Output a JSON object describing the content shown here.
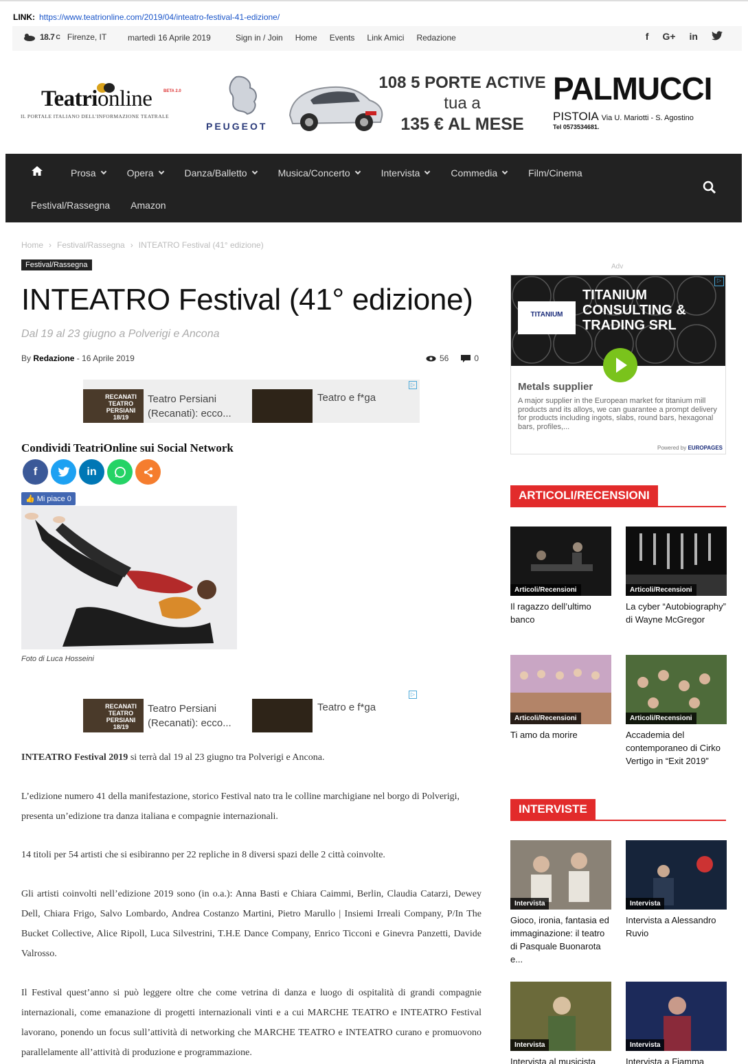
{
  "linkbar": {
    "label": "LINK:",
    "url": "https://www.teatrionline.com/2019/04/inteatro-festival-41-edizione/"
  },
  "topbar": {
    "temp": "18.7",
    "unit": "C",
    "city": "Firenze, IT",
    "date": "martedì 16 Aprile 2019",
    "nav": [
      "Sign in / Join",
      "Home",
      "Events",
      "Link Amici",
      "Redazione"
    ],
    "social": [
      "f",
      "G+",
      "in",
      "t"
    ]
  },
  "logo": {
    "name_a": "Teatri",
    "name_b": "online",
    "beta": "BETA 2.0",
    "tagline": "IL PORTALE ITALIANO DELL'INFORMAZIONE TEATRALE"
  },
  "banner": {
    "brand": "PEUGEOT",
    "line1": "108 5 PORTE ACTIVE",
    "line2": "tua a",
    "line3": "135 € AL MESE",
    "dealer": "PALMUCCI",
    "city": "PISTOIA",
    "addr": "Via U. Mariotti - S. Agostino",
    "tel": "Tel 0573534681."
  },
  "mainnav": {
    "row1": [
      {
        "label": "Prosa",
        "dropdown": true
      },
      {
        "label": "Opera",
        "dropdown": true
      },
      {
        "label": "Danza/Balletto",
        "dropdown": true
      },
      {
        "label": "Musica/Concerto",
        "dropdown": true
      },
      {
        "label": "Intervista",
        "dropdown": true
      },
      {
        "label": "Commedia",
        "dropdown": true
      },
      {
        "label": "Film/Cinema",
        "dropdown": false
      }
    ],
    "row2": [
      "Festival/Rassegna",
      "Amazon"
    ]
  },
  "breadcrumb": [
    "Home",
    "Festival/Rassegna",
    "INTEATRO Festival (41° edizione)"
  ],
  "article": {
    "category": "Festival/Rassegna",
    "title": "INTEATRO Festival (41° edizione)",
    "subtitle": "Dal 19 al 23 giugno a Polverigi e Ancona",
    "by": "By",
    "author": "Redazione",
    "date": "16 Aprile 2019",
    "views": "56",
    "comments": "0",
    "share_title": "Condividi TeatriOnline sui Social Network",
    "like_label": "Mi piace 0",
    "caption": "Foto di Luca Hosseini",
    "p1_bold": "INTEATRO Festival 2019",
    "p1_rest": " si terrà dal 19 al 23 giugno tra Polverigi e Ancona.",
    "p2": "L’edizione numero 41 della manifestazione, storico Festival nato tra le colline marchigiane nel borgo di Polverigi, presenta un’edizione tra danza italiana e compagnie internazionali.",
    "p3": "14 titoli per 54 artisti che si esibiranno per 22 repliche in 8 diversi spazi delle 2 città coinvolte.",
    "p4": "Gli artisti coinvolti nell’edizione 2019 sono (in o.a.): Anna Basti e Chiara Caimmi, Berlin, Claudia Catarzi, Dewey Dell, Chiara Frigo, Salvo Lombardo, Andrea Costanzo Martini, Pietro Marullo | Insiemi Irreali Company, P/In The Bucket Collective, Alice Ripoll, Luca Silvestrini, T.H.E Dance Company, Enrico Ticconi e Ginevra Panzetti, Davide Valrosso.",
    "p5": "Il Festival quest’anno si può leggere oltre che come vetrina di danza e luogo di ospitalità di grandi compagnie internazionali, come emanazione di progetti internazionali vinti e a cui MARCHE TEATRO e INTEATRO Festival lavorano, ponendo un focus sull’attività di networking che MARCHE TEATRO e INTEATRO curano e promuovono parallelamente all’attività di produzione e programmazione."
  },
  "inline_ad": {
    "thumb_text": "RECANATI TEATRO PERSIANI 18/19",
    "item1": "Teatro Persiani (Recanati): ecco...",
    "item2": "Teatro e f*ga"
  },
  "sidebar": {
    "adv_label": "Adv",
    "ad": {
      "logo": "TITANIUM",
      "headline": "TITANIUM CONSULTING & TRADING SRL",
      "subhead": "Metals supplier",
      "desc": "A major supplier in the European market for titanium mill products and its alloys, we can guarantee a prompt delivery for products including ingots, slabs, round bars, hexagonal bars, profiles,...",
      "powered": "Powered by",
      "powered_brand": "EUROPAGES"
    },
    "sections": [
      {
        "title": "ARTICOLI/RECENSIONI",
        "cards": [
          {
            "label": "Articoli/Recensioni",
            "title": "Il ragazzo dell’ultimo banco"
          },
          {
            "label": "Articoli/Recensioni",
            "title": "La cyber “Autobiography” di Wayne McGregor"
          },
          {
            "label": "Articoli/Recensioni",
            "title": "Ti amo da morire"
          },
          {
            "label": "Articoli/Recensioni",
            "title": "Accademia del contemporaneo di Cirko Vertigo in “Exit 2019”"
          }
        ]
      },
      {
        "title": "INTERVISTE",
        "cards": [
          {
            "label": "Intervista",
            "title": "Gioco, ironia, fantasia ed immaginazione: il teatro di Pasquale Buonarota e..."
          },
          {
            "label": "Intervista",
            "title": "Intervista a Alessandro Ruvio"
          },
          {
            "label": "Intervista",
            "title": "Intervista al musicista"
          },
          {
            "label": "Intervista",
            "title": "Intervista a Fiamma"
          }
        ]
      }
    ]
  },
  "colors": {
    "accent": "#e22b2b",
    "nav_bg": "#222222",
    "link": "#1a55c9"
  }
}
